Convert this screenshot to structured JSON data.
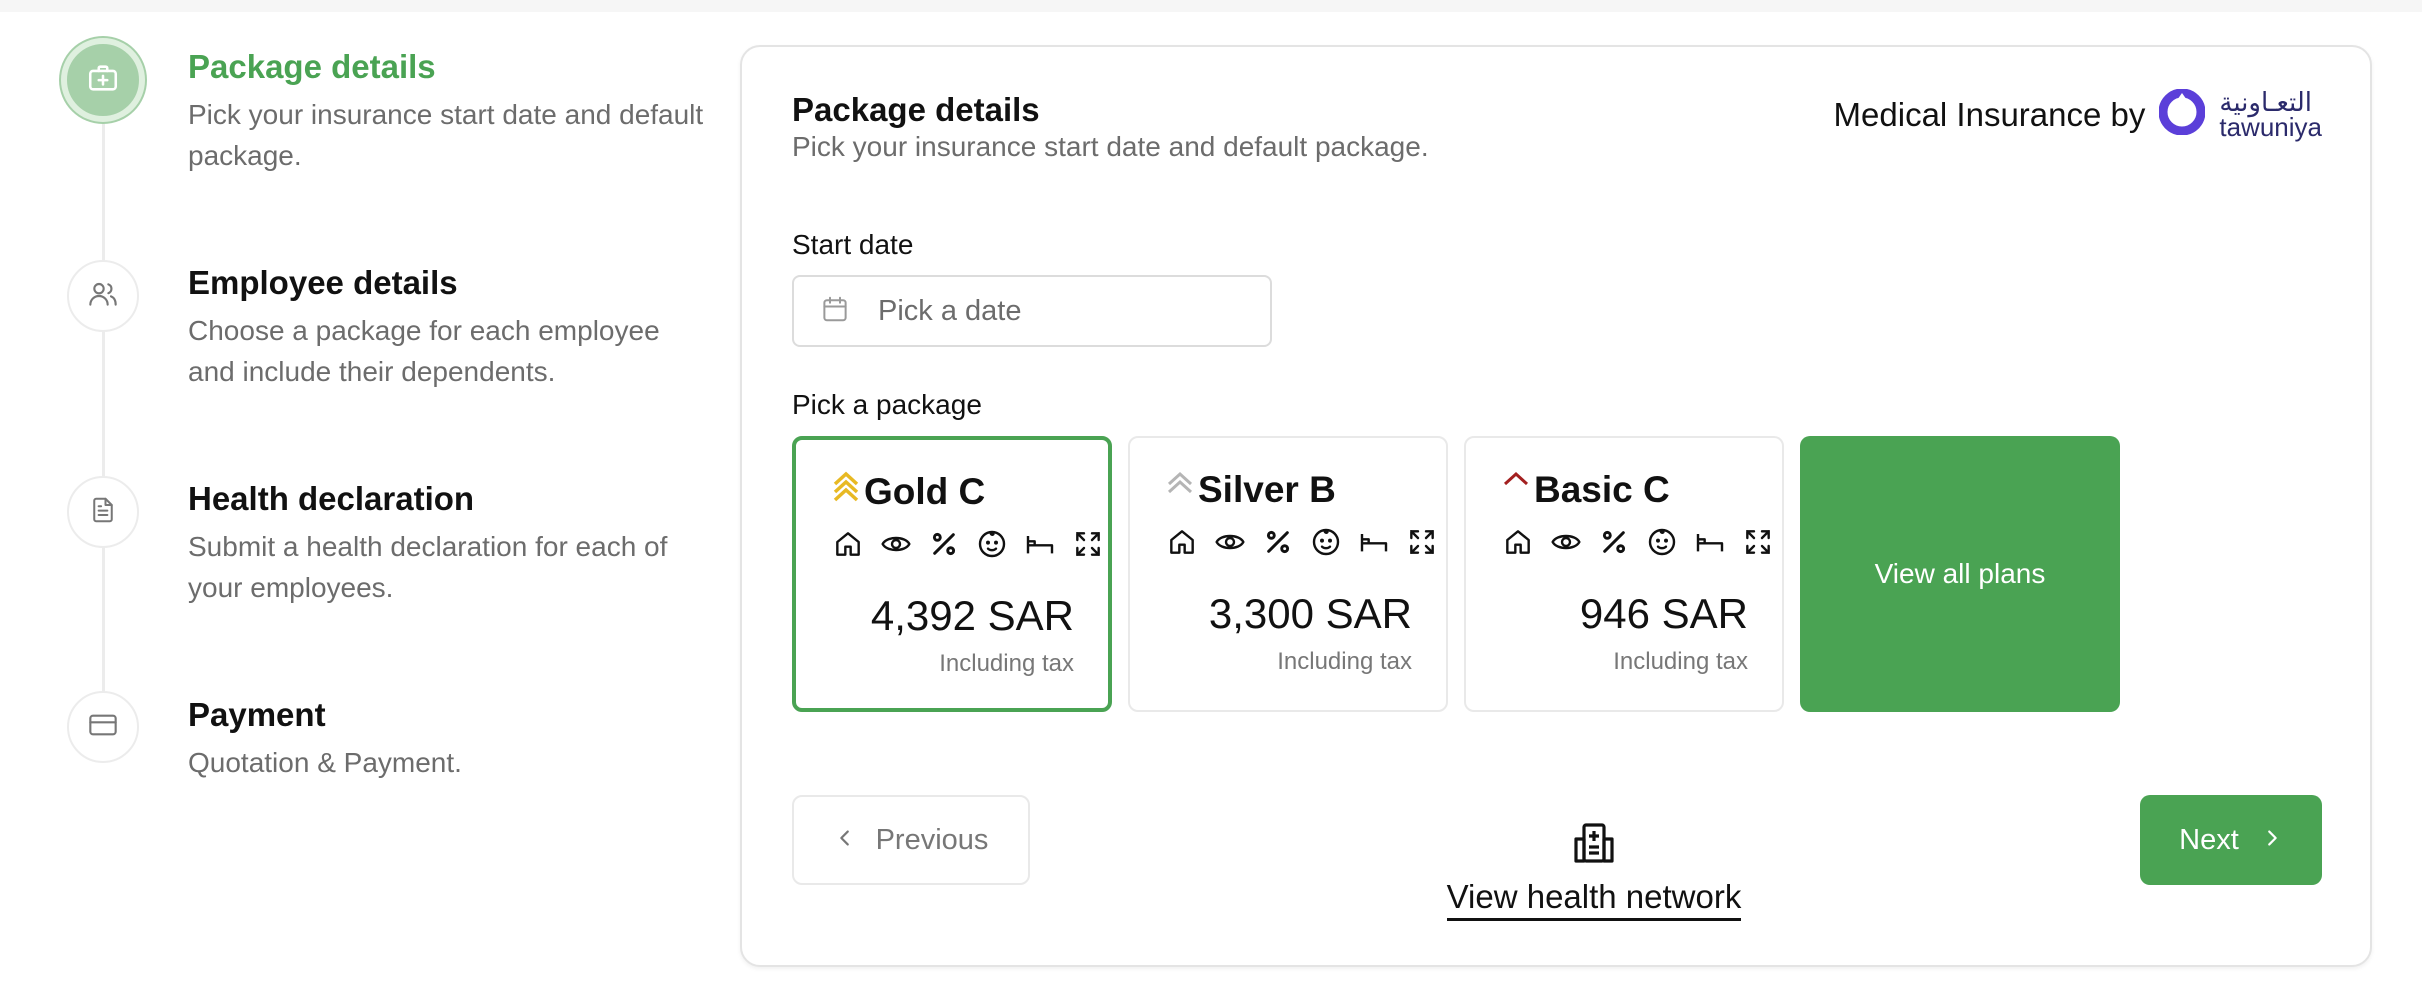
{
  "stepper": {
    "steps": [
      {
        "title": "Package details",
        "description": "Pick your insurance start date and default package.",
        "icon": "medical-bag-icon",
        "active": true
      },
      {
        "title": "Employee details",
        "description": "Choose a package for each employee and include their dependents.",
        "icon": "users-icon",
        "active": false
      },
      {
        "title": "Health declaration",
        "description": "Submit a health declaration for each of your employees.",
        "icon": "document-icon",
        "active": false
      },
      {
        "title": "Payment",
        "description": "Quotation & Payment.",
        "icon": "credit-card-icon",
        "active": false
      }
    ]
  },
  "card": {
    "title": "Package details",
    "subtitle": "Pick your insurance start date and default package.",
    "brand_label": "Medical Insurance by",
    "brand_logo_ar": "التعـاونية",
    "brand_logo_en": "tawuniya"
  },
  "start_date": {
    "label": "Start date",
    "placeholder": "Pick a date"
  },
  "packages": {
    "label": "Pick a package",
    "items": [
      {
        "name": "Gold C",
        "price": "4,392 SAR",
        "tax_note": "Including tax",
        "tier_icon": "gold-chevrons-icon",
        "selected": true
      },
      {
        "name": "Silver B",
        "price": "3,300 SAR",
        "tax_note": "Including tax",
        "tier_icon": "silver-chevrons-icon",
        "selected": false
      },
      {
        "name": "Basic C",
        "price": "946 SAR",
        "tax_note": "Including tax",
        "tier_icon": "basic-chevron-icon",
        "selected": false
      }
    ],
    "feature_icons": [
      "home-icon",
      "eye-icon",
      "percent-icon",
      "baby-icon",
      "bed-icon",
      "expand-icon"
    ],
    "view_all_label": "View all plans"
  },
  "actions": {
    "previous_label": "Previous",
    "next_label": "Next",
    "network_label": "View health network"
  },
  "colors": {
    "accent": "#4aa353",
    "gold": "#e8b923",
    "silver": "#b5b5b5",
    "basic": "#a32020",
    "brand": "#5b3fd9"
  }
}
